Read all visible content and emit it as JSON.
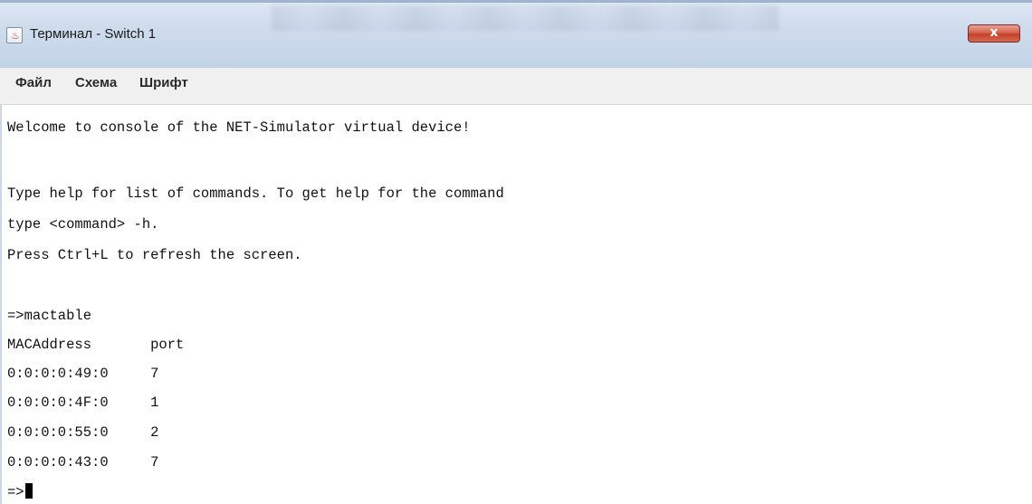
{
  "window": {
    "title": "Терминал - Switch 1",
    "close_label": "x"
  },
  "menu": {
    "items": [
      {
        "label": "Файл"
      },
      {
        "label": "Схема"
      },
      {
        "label": "Шрифт"
      }
    ]
  },
  "terminal": {
    "lines": [
      "Welcome to console of the NET-Simulator virtual device!",
      "",
      "Type help for list of commands. To get help for the command",
      "type <command> -h.",
      "Press Ctrl+L to refresh the screen.",
      "",
      "=>mactable",
      "MACAddress       port",
      "0:0:0:0:49:0     7",
      "0:0:0:0:4F:0     1",
      "0:0:0:0:55:0     2",
      "0:0:0:0:43:0     7"
    ],
    "prompt": "=>"
  },
  "colors": {
    "close_button": "#c7402a",
    "menubar_bg": "#f0f0f0",
    "terminal_bg": "#ffffff",
    "text": "#111111"
  },
  "icons": {
    "app_icon": "java-cup-icon"
  }
}
